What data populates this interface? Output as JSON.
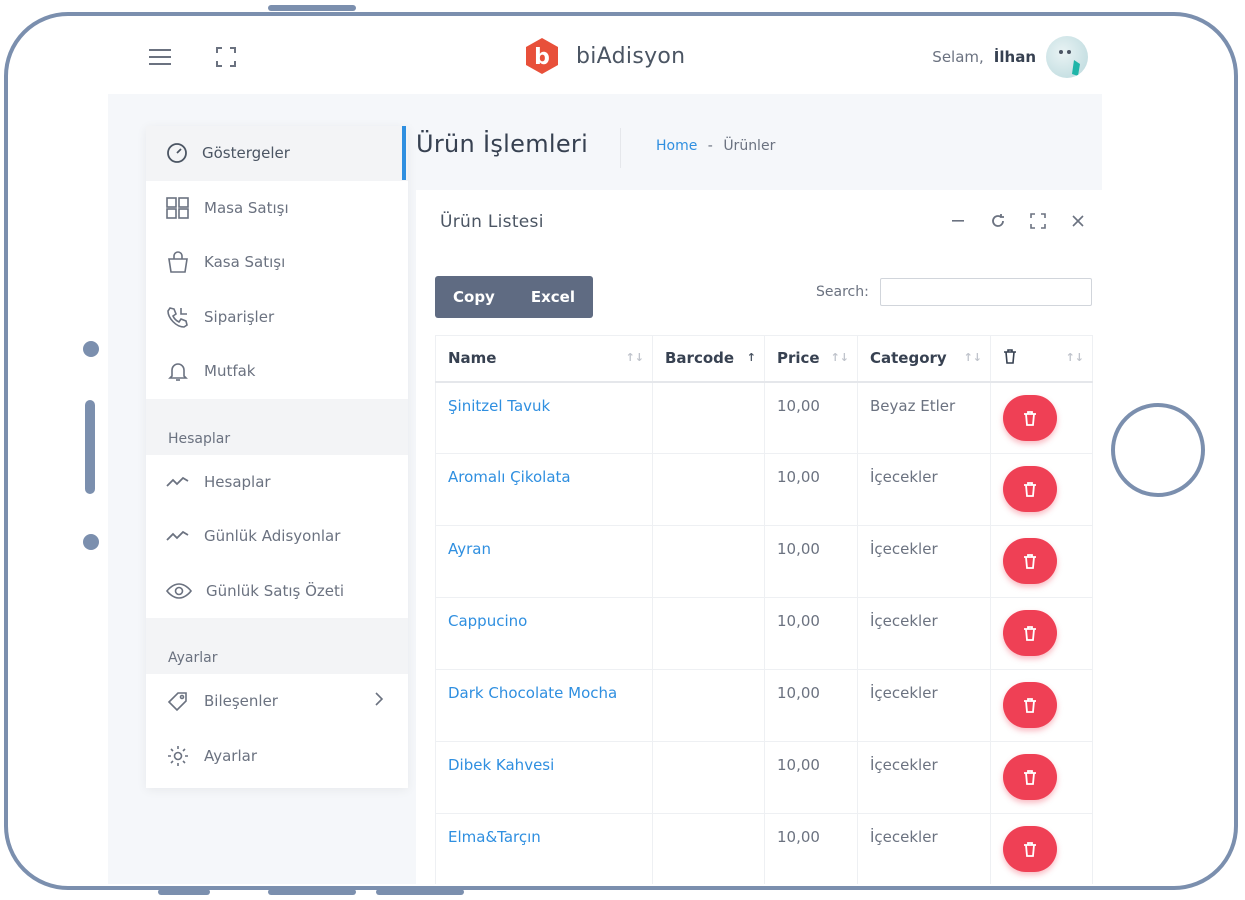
{
  "header": {
    "brand_name": "biAdisyon",
    "greeting": "Selam,",
    "user_name": "İlhan"
  },
  "sidebar": {
    "items": [
      {
        "label": "Göstergeler",
        "icon": "gauge-icon"
      },
      {
        "label": "Masa Satışı",
        "icon": "grid-icon"
      },
      {
        "label": "Kasa Satışı",
        "icon": "shopping-bag-icon"
      },
      {
        "label": "Siparişler",
        "icon": "phone-icon"
      },
      {
        "label": "Mutfak",
        "icon": "bell-icon"
      }
    ],
    "section_accounts": "Hesaplar",
    "account_items": [
      {
        "label": "Hesaplar",
        "icon": "trend-icon"
      },
      {
        "label": "Günlük Adisyonlar",
        "icon": "trend-icon"
      },
      {
        "label": "Günlük Satış Özeti",
        "icon": "eye-icon"
      }
    ],
    "section_settings": "Ayarlar",
    "settings_items": [
      {
        "label": "Bileşenler",
        "icon": "tag-icon"
      },
      {
        "label": "Ayarlar",
        "icon": "gear-icon"
      }
    ]
  },
  "page": {
    "title": "Ürün İşlemleri",
    "breadcrumb_home": "Home",
    "breadcrumb_sep": "-",
    "breadcrumb_current": "Ürünler"
  },
  "panel": {
    "title": "Ürün Listesi",
    "copy_label": "Copy",
    "excel_label": "Excel",
    "search_label": "Search:",
    "search_value": ""
  },
  "table": {
    "columns": [
      "Name",
      "Barcode",
      "Price",
      "Category"
    ],
    "rows": [
      {
        "name": "Şinitzel Tavuk",
        "barcode": "",
        "price": "10,00",
        "category": "Beyaz Etler"
      },
      {
        "name": "Aromalı Çikolata",
        "barcode": "",
        "price": "10,00",
        "category": "İçecekler"
      },
      {
        "name": "Ayran",
        "barcode": "",
        "price": "10,00",
        "category": "İçecekler"
      },
      {
        "name": "Cappucino",
        "barcode": "",
        "price": "10,00",
        "category": "İçecekler"
      },
      {
        "name": "Dark Chocolate Mocha",
        "barcode": "",
        "price": "10,00",
        "category": "İçecekler"
      },
      {
        "name": "Dibek Kahvesi",
        "barcode": "",
        "price": "10,00",
        "category": "İçecekler"
      },
      {
        "name": "Elma&Tarçın",
        "barcode": "",
        "price": "10,00",
        "category": "İçecekler"
      }
    ]
  },
  "colors": {
    "accent": "#2f8fe0",
    "danger": "#ef4055",
    "frame": "#7b8fae",
    "brand": "#e8503a"
  }
}
